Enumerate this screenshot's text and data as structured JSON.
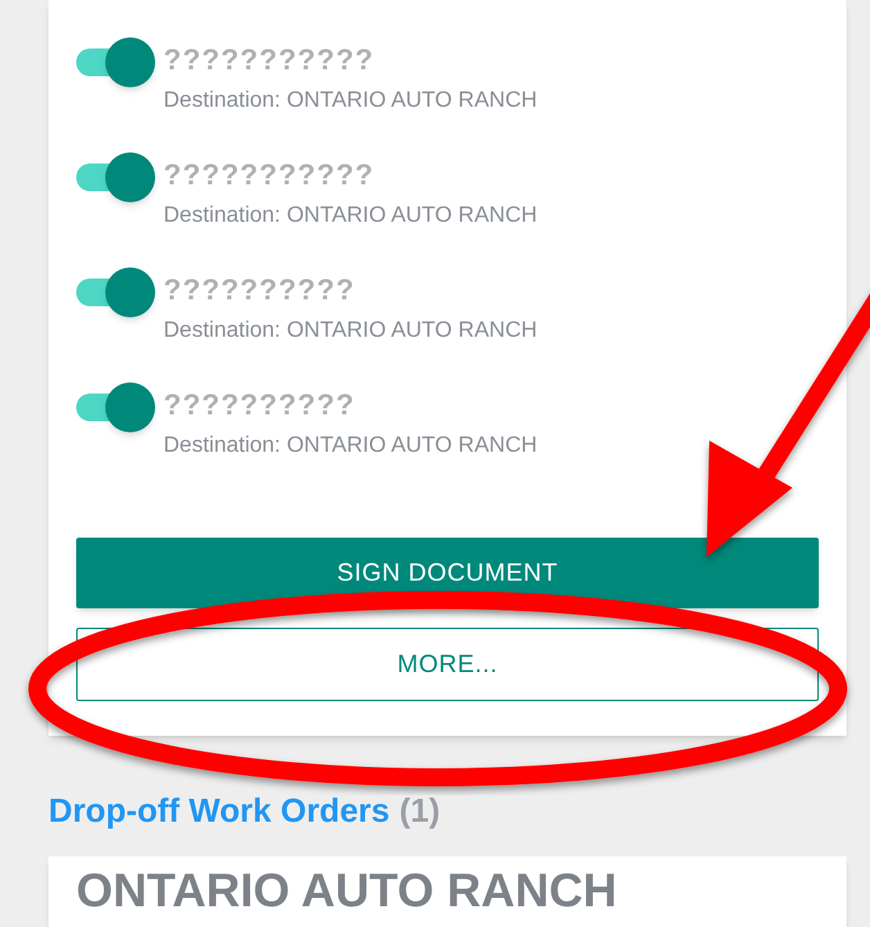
{
  "items": [
    {
      "title": "???????????",
      "on": true,
      "destination": "Destination: ONTARIO AUTO RANCH"
    },
    {
      "title": "???????????",
      "on": true,
      "destination": "Destination: ONTARIO AUTO RANCH"
    },
    {
      "title": "??????????",
      "on": true,
      "destination": "Destination: ONTARIO AUTO RANCH"
    },
    {
      "title": "??????????",
      "on": true,
      "destination": "Destination: ONTARIO AUTO RANCH"
    }
  ],
  "buttons": [
    {
      "label": "SIGN DOCUMENT",
      "kind": "primary"
    },
    {
      "label": "MORE...",
      "kind": "outline"
    }
  ],
  "section": {
    "title": "Drop-off Work Orders",
    "count": "(1)"
  },
  "next_card": {
    "title": "ONTARIO AUTO RANCH"
  }
}
